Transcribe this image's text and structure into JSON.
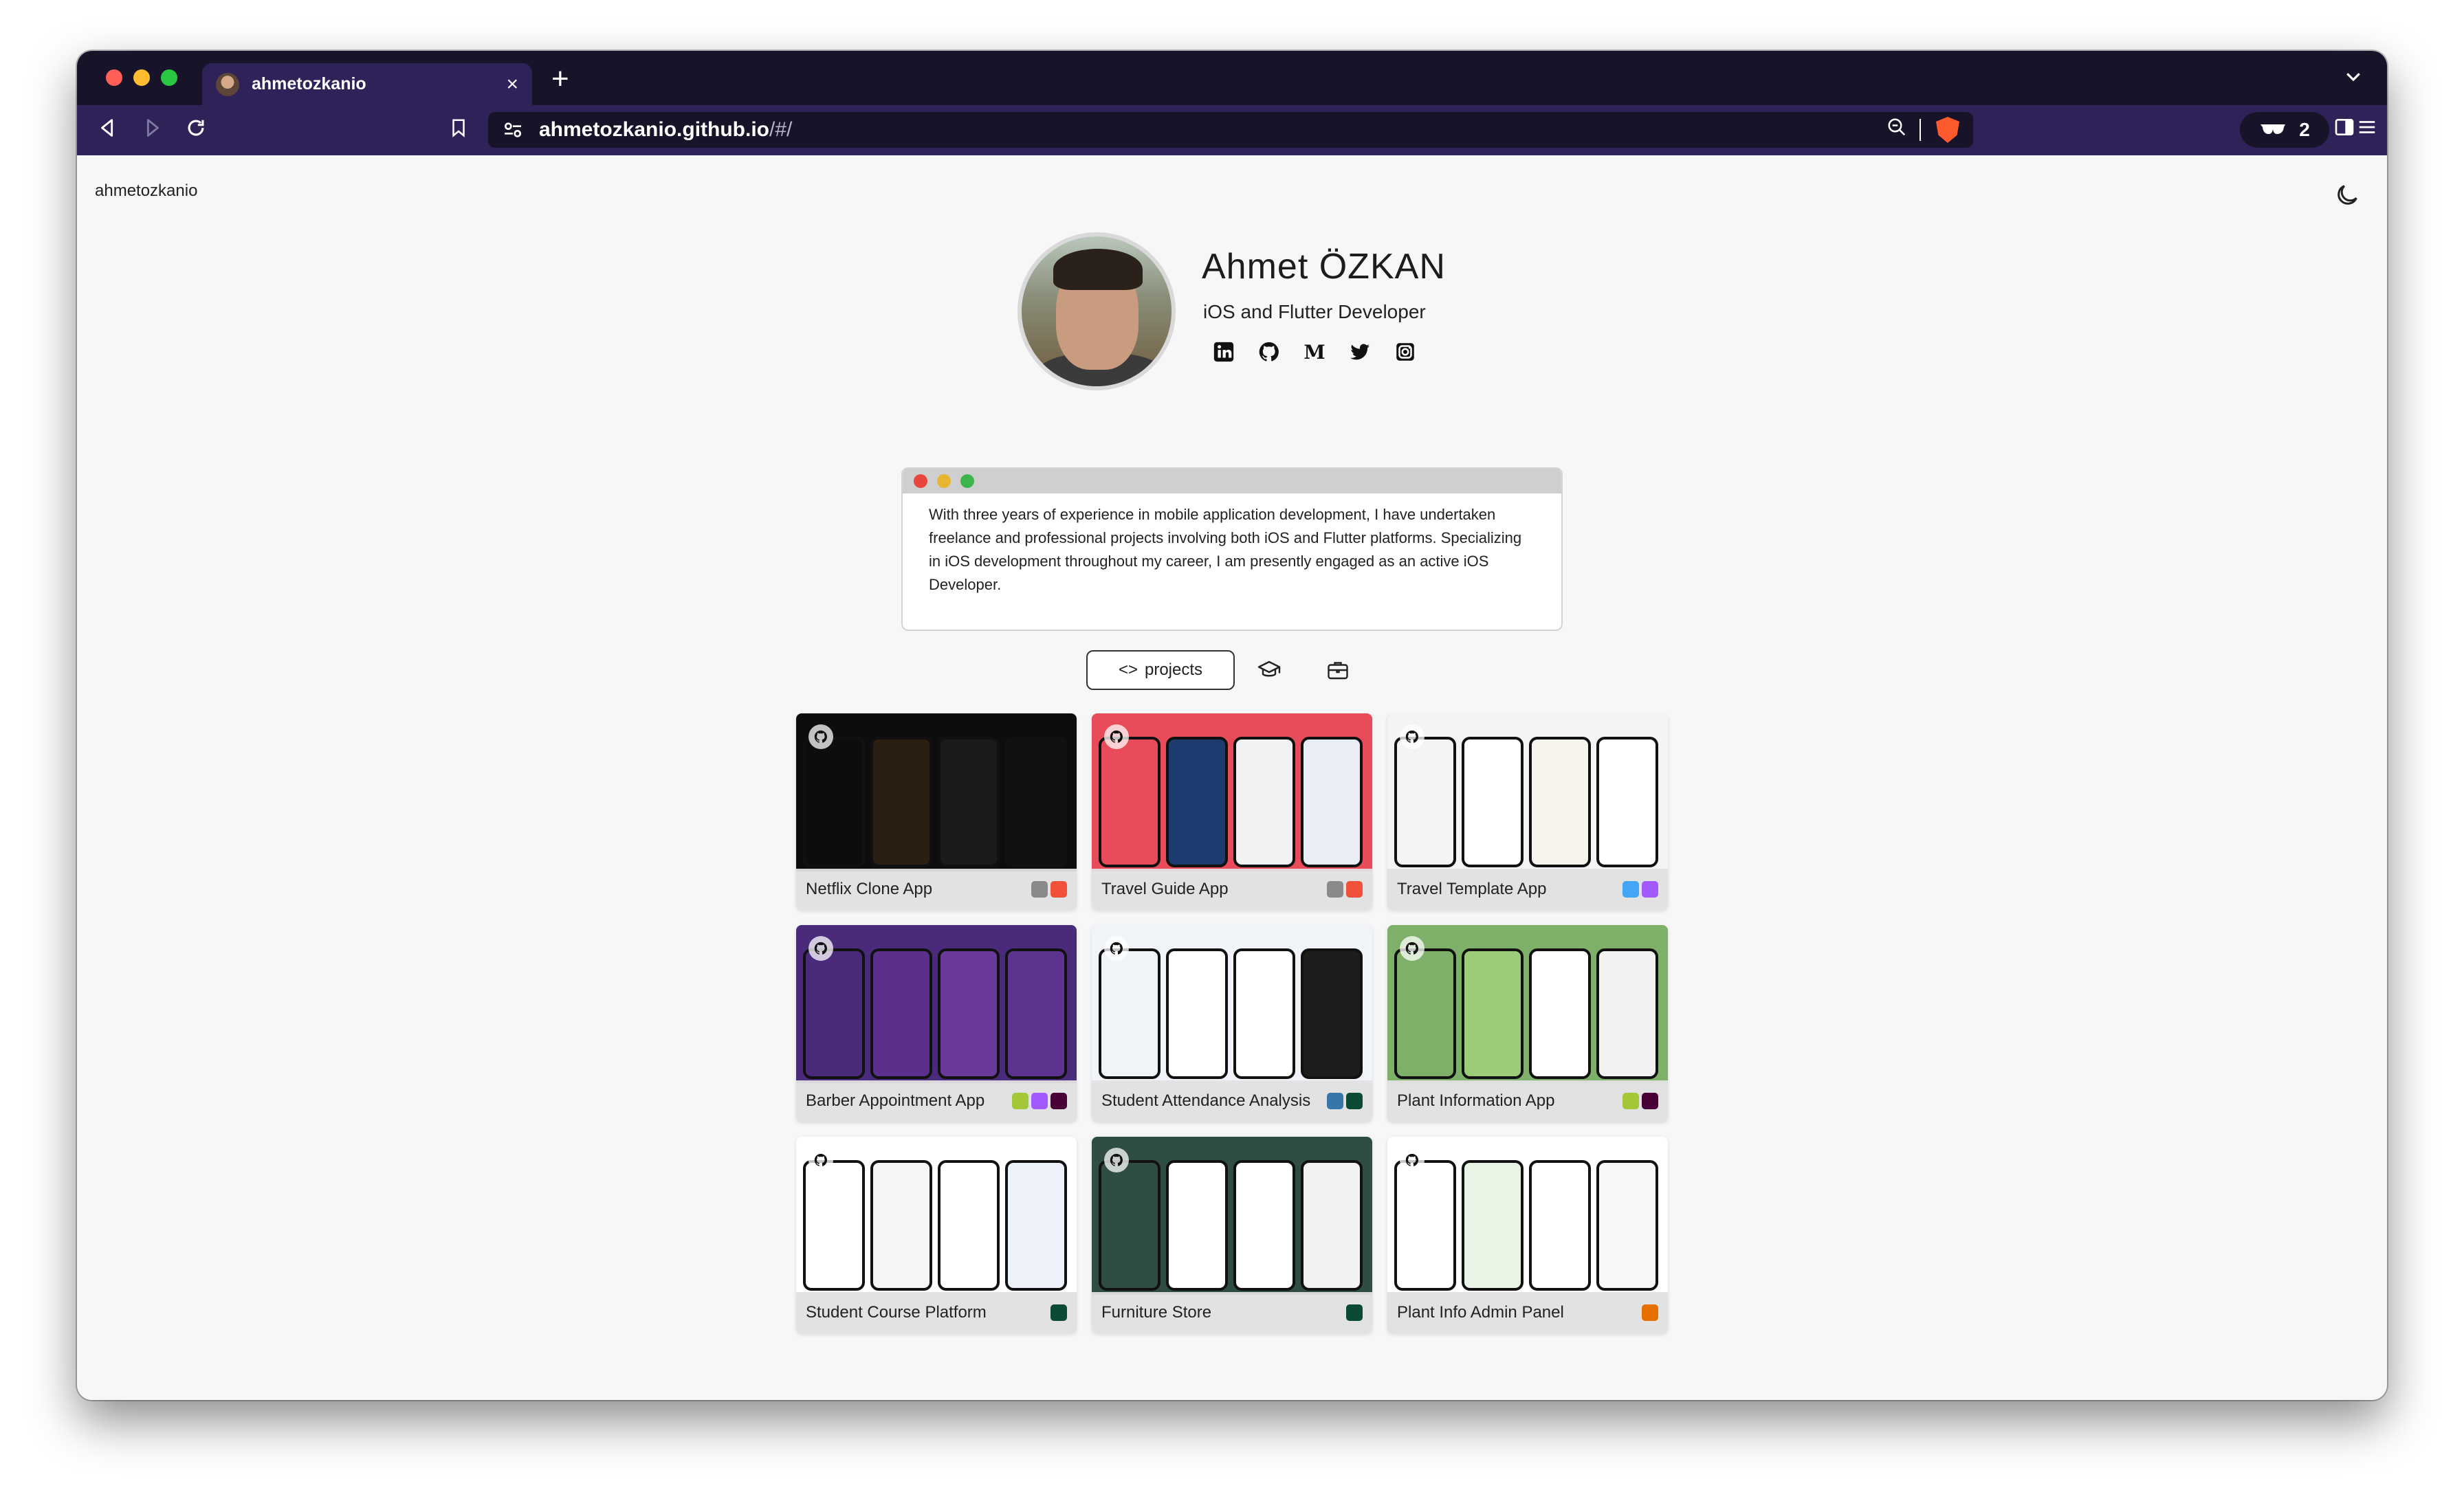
{
  "browser": {
    "tab_title": "ahmetozkanio",
    "tab_close": "×",
    "new_tab": "+",
    "url_host": "ahmetozkanio.github.io",
    "url_path": "/#/",
    "profile_count": "2",
    "colors": {
      "titlebar": "#17142a",
      "toolbar": "#2e2258"
    }
  },
  "site": {
    "logo_text": "ahmetozkanio"
  },
  "profile": {
    "name": "Ahmet ÖZKAN",
    "role": "iOS and Flutter Developer",
    "socials": [
      "linkedin-icon",
      "github-icon",
      "medium-icon",
      "twitter-icon",
      "instagram-icon"
    ]
  },
  "bio": {
    "text": "With three years of experience in mobile application development, I have undertaken freelance and professional projects involving both iOS and Flutter platforms. Specializing in iOS development throughout my career, I am presently engaged as an active iOS Developer."
  },
  "tabs": {
    "projects_label": "projects",
    "projects_icon": "<>"
  },
  "projects": [
    {
      "title": "Netflix Clone App",
      "tech": [
        "apple",
        "swift"
      ],
      "screens": [
        "#0d0d0d",
        "#2a1f12",
        "#1a1a1a",
        "#111111"
      ]
    },
    {
      "title": "Travel Guide App",
      "tech": [
        "apple",
        "swift"
      ],
      "screens": [
        "#e84b5a",
        "#1d3b6e",
        "#f2f2f2",
        "#e9eef5"
      ]
    },
    {
      "title": "Travel Template App",
      "tech": [
        "flutter",
        "figma"
      ],
      "screens": [
        "#f4f4f4",
        "#ffffff",
        "#f7f4ee",
        "#ffffff"
      ]
    },
    {
      "title": "Barber Appointment App",
      "tech": [
        "android",
        "figma",
        "xd"
      ],
      "screens": [
        "#4a2a7a",
        "#5b2f8c",
        "#6a3a9a",
        "#5d3390"
      ]
    },
    {
      "title": "Student Attendance Analysis",
      "tech": [
        "python",
        "django"
      ],
      "screens": [
        "#f0f3f7",
        "#ffffff",
        "#ffffff",
        "#1c1c1c"
      ]
    },
    {
      "title": "Plant Information App",
      "tech": [
        "android",
        "xd"
      ],
      "screens": [
        "#7fb069",
        "#9ccc7a",
        "#ffffff",
        "#f2f2f2"
      ]
    },
    {
      "title": "Student Course Platform",
      "tech": [
        "django"
      ],
      "screens": [
        "#ffffff",
        "#f5f5f5",
        "#ffffff",
        "#eef3fb"
      ]
    },
    {
      "title": "Furniture Store",
      "tech": [
        "django"
      ],
      "screens": [
        "#2f4d45",
        "#ffffff",
        "#ffffff",
        "#f2f2f2"
      ]
    },
    {
      "title": "Plant Info Admin Panel",
      "tech": [
        "java"
      ],
      "screens": [
        "#ffffff",
        "#eaf4e4",
        "#ffffff",
        "#f7f7f7"
      ]
    }
  ]
}
